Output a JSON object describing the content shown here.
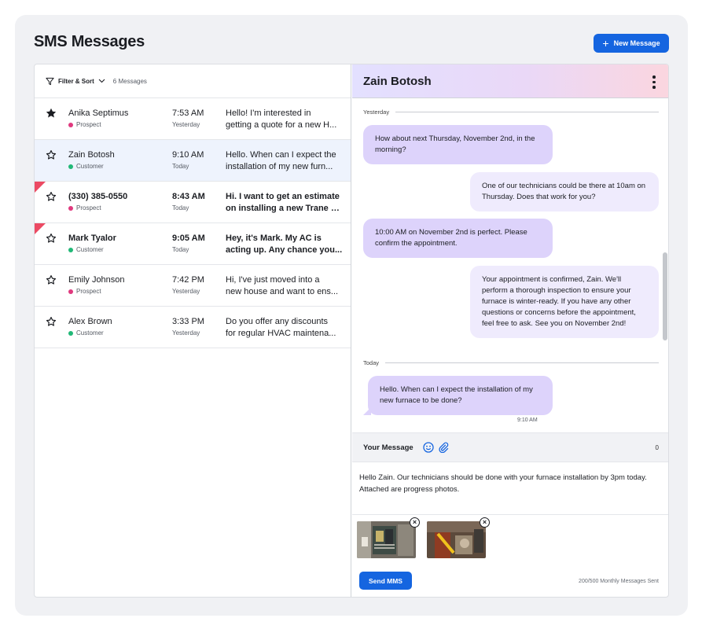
{
  "header": {
    "title": "SMS Messages",
    "new_message_label": "New Message",
    "new_message_icon": "plus-icon"
  },
  "list": {
    "filter_label": "Filter & Sort",
    "message_count": "6 Messages",
    "rows": [
      {
        "name": "Anika Septimus",
        "tag": "Prospect",
        "time": "7:53 AM",
        "day": "Yesterday",
        "preview_line1": "Hello! I'm interested in",
        "preview_line2": "getting a quote for a new H...",
        "starred": true
      },
      {
        "name": "Zain Botosh",
        "tag": "Customer",
        "time": "9:10 AM",
        "day": "Today",
        "preview_line1": "Hello. When can I expect the",
        "preview_line2": "installation of my new furn...",
        "selected": true
      },
      {
        "name": "(330) 385-0550",
        "tag": "Prospect",
        "time": "8:43 AM",
        "day": "Today",
        "preview_line1": "Hi. I want to get an estimate",
        "preview_line2": "on installing a new Trane X...",
        "unread": true
      },
      {
        "name": "Mark Tyalor",
        "tag": "Customer",
        "time": "9:05 AM",
        "day": "Today",
        "preview_line1": "Hey, it's Mark. My AC is",
        "preview_line2": "acting up. Any chance you...",
        "unread": true
      },
      {
        "name": "Emily Johnson",
        "tag": "Prospect",
        "time": "7:42 PM",
        "day": "Yesterday",
        "preview_line1": "Hi, I've just moved into a",
        "preview_line2": "new house and want to ens..."
      },
      {
        "name": "Alex Brown",
        "tag": "Customer",
        "time": "3:33 PM",
        "day": "Yesterday",
        "preview_line1": "Do you offer any discounts",
        "preview_line2": "for regular HVAC maintena..."
      }
    ]
  },
  "conversation": {
    "contact_name": "Zain Botosh",
    "divider_yesterday": "Yesterday",
    "divider_today": "Today",
    "messages": [
      {
        "direction": "in",
        "text": "How about next Thursday, November 2nd, in the morning?"
      },
      {
        "direction": "out",
        "text": "One of our technicians could be there at 10am on Thursday.  Does that work for you?"
      },
      {
        "direction": "in",
        "text": "10:00 AM on November 2nd is perfect. Please confirm the appointment."
      },
      {
        "direction": "out",
        "text": "Your appointment is confirmed, Zain. We'll perform a thorough inspection to ensure your furnace is winter-ready.  If you have any other questions or concerns before the appointment, feel free to ask. See you on November 2nd!"
      },
      {
        "direction": "in",
        "text": "Hello. When can I expect the installation of my new furnace to be done?"
      }
    ],
    "last_timestamp": "9:10 AM"
  },
  "compose": {
    "label": "Your Message",
    "char_count": "0",
    "text": "Hello Zain. Our technicians should be done with your furnace installation by 3pm today. Attached are progress photos.",
    "send_label": "Send MMS",
    "usage": "200/500 Monthly Messages Sent"
  },
  "colors": {
    "accent": "#1565e0",
    "prospect": "#e0397e",
    "customer": "#21b877",
    "unread_flag": "#ec4a63"
  }
}
